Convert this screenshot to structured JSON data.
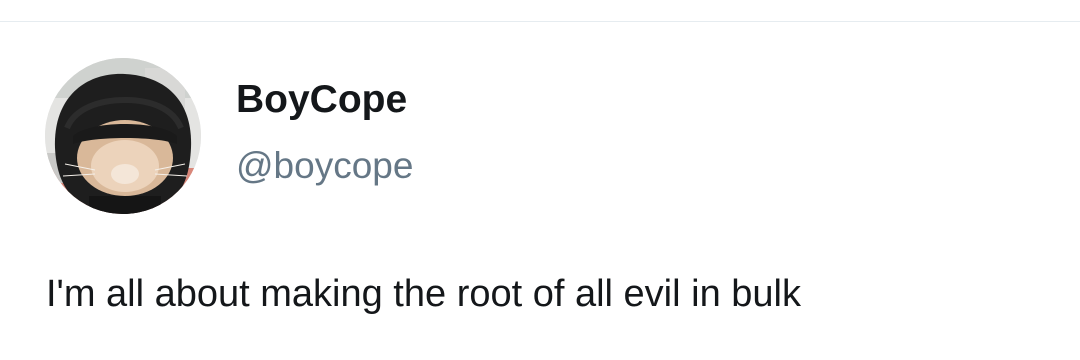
{
  "tweet": {
    "author": {
      "display_name": "BoyCope",
      "handle": "@boycope",
      "avatar_icon": "hooded-cat-avatar"
    },
    "text": "I'm all about making the root of all evil in bulk"
  },
  "colors": {
    "background": "#ffffff",
    "primary_text": "#14171a",
    "secondary_text": "#657786",
    "divider": "#e6ecf0"
  }
}
